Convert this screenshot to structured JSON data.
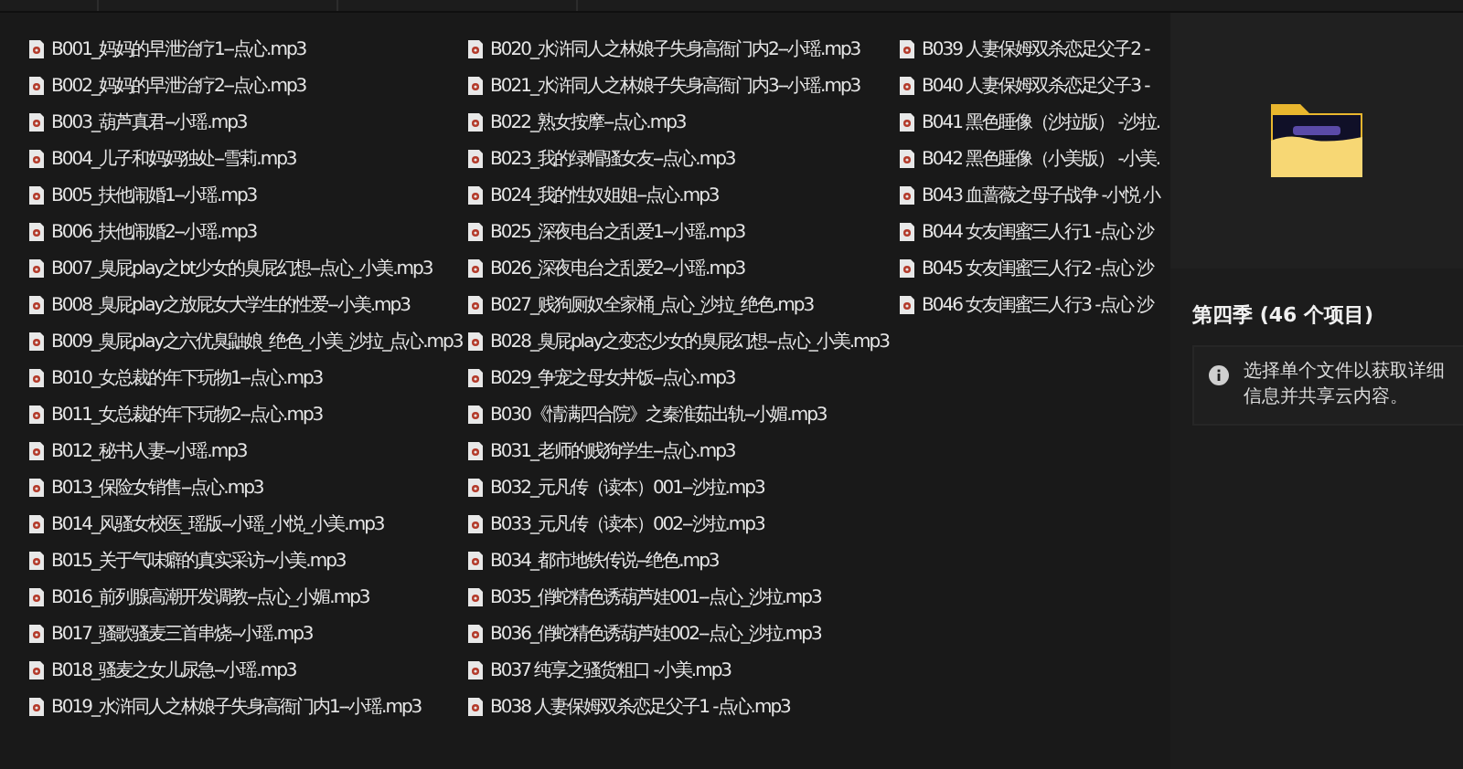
{
  "files": [
    {
      "name": "B001_妈妈的早泄治疗1--点心.mp3"
    },
    {
      "name": "B002_妈妈的早泄治疗2--点心.mp3"
    },
    {
      "name": "B003_葫芦真君--小瑶.mp3"
    },
    {
      "name": "B004_儿子和妈妈独处--雪莉.mp3"
    },
    {
      "name": "B005_扶他闹婚1--小瑶.mp3"
    },
    {
      "name": "B006_扶他闹婚2--小瑶.mp3"
    },
    {
      "name": "B007_臭屁play之bt少女的臭屁幻想--点心_小美.mp3"
    },
    {
      "name": "B008_臭屁play之放屁女大学生的性爱--小美.mp3"
    },
    {
      "name": "B009_臭屁play之六优臭鼬娘_绝色_小美_沙拉_点心.mp3"
    },
    {
      "name": "B010_女总裁的年下玩物1--点心.mp3"
    },
    {
      "name": "B011_女总裁的年下玩物2--点心.mp3"
    },
    {
      "name": "B012_秘书人妻--小瑶.mp3"
    },
    {
      "name": "B013_保险女销售--点心.mp3"
    },
    {
      "name": "B014_风骚女校医_瑶版--小瑶_小悦_小美.mp3"
    },
    {
      "name": "B015_关于气味癖的真实采访--小美.mp3"
    },
    {
      "name": "B016_前列腺高潮开发调教--点心_小媚.mp3"
    },
    {
      "name": "B017_骚歌骚麦三首串烧--小瑶.mp3"
    },
    {
      "name": "B018_骚麦之女儿尿急--小瑶.mp3"
    },
    {
      "name": "B019_水浒同人之林娘子失身高衙门内1--小瑶.mp3"
    },
    {
      "name": "B020_水浒同人之林娘子失身高衙门内2--小瑶.mp3"
    },
    {
      "name": "B021_水浒同人之林娘子失身高衙门内3--小瑶.mp3"
    },
    {
      "name": "B022_熟女按摩--点心.mp3"
    },
    {
      "name": "B023_我的绿帽骚女友--点心.mp3"
    },
    {
      "name": "B024_我的性奴姐姐--点心.mp3"
    },
    {
      "name": "B025_深夜电台之乱爱1--小瑶.mp3"
    },
    {
      "name": "B026_深夜电台之乱爱2--小瑶.mp3"
    },
    {
      "name": "B027_贱狗厕奴全家桶_点心_沙拉_绝色.mp3"
    },
    {
      "name": "B028_臭屁play之变态少女的臭屁幻想--点心_小美.mp3"
    },
    {
      "name": "B029_争宠之母女丼饭--点心.mp3"
    },
    {
      "name": "B030《情满四合院》之秦淮茹出轨--小媚.mp3"
    },
    {
      "name": "B031_老师的贱狗学生--点心.mp3"
    },
    {
      "name": "B032_元凡传（读本）001--沙拉.mp3"
    },
    {
      "name": "B033_元凡传（读本）002--沙拉.mp3"
    },
    {
      "name": "B034_都市地铁传说--绝色.mp3"
    },
    {
      "name": "B035_俏蛇精色诱葫芦娃001--点心_沙拉.mp3"
    },
    {
      "name": "B036_俏蛇精色诱葫芦娃002--点心_沙拉.mp3"
    },
    {
      "name": "B037 纯享之骚货粗口 -小美.mp3"
    },
    {
      "name": "B038 人妻保姆双杀恋足父子1 -点心.mp3"
    },
    {
      "name": "B039 人妻保姆双杀恋足父子2 -"
    },
    {
      "name": "B040 人妻保姆双杀恋足父子3 -"
    },
    {
      "name": "B041 黑色睡像（沙拉版） -沙拉."
    },
    {
      "name": "B042 黑色睡像（小美版） -小美."
    },
    {
      "name": "B043 血蔷薇之母子战争 -小悦 小"
    },
    {
      "name": "B044 女友闺蜜三人行1 -点心 沙"
    },
    {
      "name": "B045 女友闺蜜三人行2 -点心 沙"
    },
    {
      "name": "B046 女友闺蜜三人行3 -点心 沙"
    }
  ],
  "details": {
    "title": "第四季 (46 个项目)",
    "info": "选择单个文件以获取详细信息并共享云内容。"
  }
}
